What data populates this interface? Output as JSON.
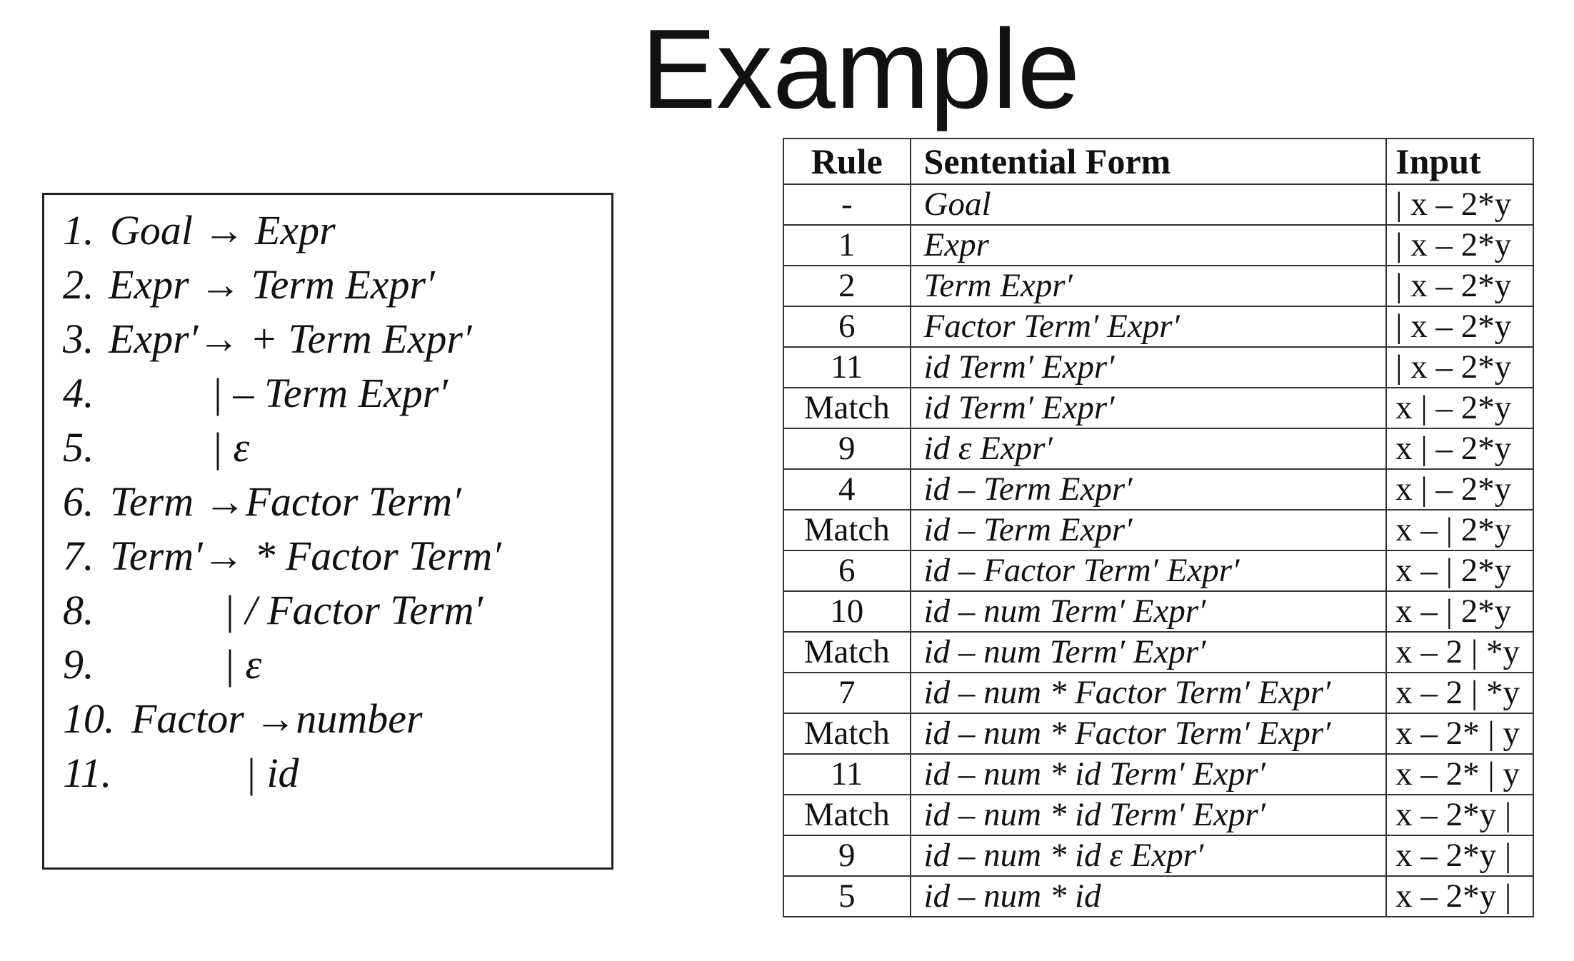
{
  "title": "Example",
  "grammar": [
    {
      "num": "1.",
      "body": "Goal → Expr"
    },
    {
      "num": "2.",
      "body": "Expr → Term Expr′"
    },
    {
      "num": "3.",
      "body": "Expr′→ + Term Expr′"
    },
    {
      "num": "4.",
      "body": "| – Term Expr′"
    },
    {
      "num": "5.",
      "body": "| ε"
    },
    {
      "num": "6.",
      "body": "Term →Factor Term′"
    },
    {
      "num": "7.",
      "body": "Term′→ * Factor Term′"
    },
    {
      "num": "8.",
      "body": "| / Factor Term′"
    },
    {
      "num": "9.",
      "body": "| ε"
    },
    {
      "num": "10.",
      "body": "Factor →number"
    },
    {
      "num": "11.",
      "body": "| id"
    }
  ],
  "table": {
    "headers": [
      "Rule",
      "Sentential Form",
      "Input"
    ],
    "rows": [
      {
        "rule": "-",
        "form": "Goal",
        "input": "| x – 2*y"
      },
      {
        "rule": "1",
        "form": "Expr",
        "input": "| x – 2*y"
      },
      {
        "rule": "2",
        "form": "Term Expr′",
        "input": "| x – 2*y"
      },
      {
        "rule": "6",
        "form": "Factor Term′ Expr′",
        "input": "| x – 2*y"
      },
      {
        "rule": "11",
        "form": "id Term′ Expr′",
        "input": "| x – 2*y"
      },
      {
        "rule": "Match",
        "form": "id Term′ Expr′",
        "input": "x | – 2*y"
      },
      {
        "rule": "9",
        "form": "id ε Expr′",
        "input": "x | – 2*y"
      },
      {
        "rule": "4",
        "form": "id – Term Expr′",
        "input": "x | – 2*y"
      },
      {
        "rule": "Match",
        "form": "id – Term Expr′",
        "input": "x – | 2*y"
      },
      {
        "rule": "6",
        "form": "id – Factor Term′ Expr′",
        "input": "x – | 2*y"
      },
      {
        "rule": "10",
        "form": "id – num Term′ Expr′",
        "input": "x – | 2*y"
      },
      {
        "rule": "Match",
        "form": "id – num Term′ Expr′",
        "input": "x – 2 | *y"
      },
      {
        "rule": "7",
        "form": "id – num * Factor Term′ Expr′",
        "input": "x – 2 | *y"
      },
      {
        "rule": "Match",
        "form": "id – num * Factor Term′ Expr′",
        "input": "x – 2* | y"
      },
      {
        "rule": "11",
        "form": "id – num * id  Term′ Expr′",
        "input": "x – 2* | y"
      },
      {
        "rule": "Match",
        "form": "id – num * id Term′ Expr′",
        "input": "x – 2*y |"
      },
      {
        "rule": "9",
        "form": "id – num * id ε Expr′",
        "input": "x – 2*y |"
      },
      {
        "rule": "5",
        "form": "id – num * id",
        "input": "x – 2*y |"
      }
    ]
  }
}
